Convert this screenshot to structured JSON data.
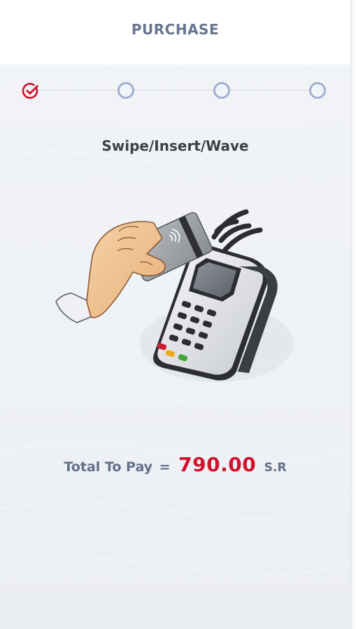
{
  "header": {
    "title": "PURCHASE"
  },
  "stepper": {
    "total_steps": 4,
    "completed_steps": 1,
    "steps": [
      {
        "state": "completed",
        "icon": "check-circle-icon"
      },
      {
        "state": "pending",
        "icon": "circle-outline-icon"
      },
      {
        "state": "pending",
        "icon": "circle-outline-icon"
      },
      {
        "state": "pending",
        "icon": "circle-outline-icon"
      }
    ]
  },
  "instruction": "Swipe/Insert/Wave",
  "illustration": {
    "icon": "card-payment-terminal-illustration"
  },
  "total": {
    "label": "Total To Pay",
    "equals": "=",
    "amount": "790.00",
    "currency": "S.R"
  },
  "colors": {
    "accent": "#d0122c",
    "header_text": "#67758f",
    "step_pending": "#9fb2cf",
    "instruction_text": "#3d4046",
    "total_label": "#62708a",
    "background": "#f2f4f7"
  }
}
